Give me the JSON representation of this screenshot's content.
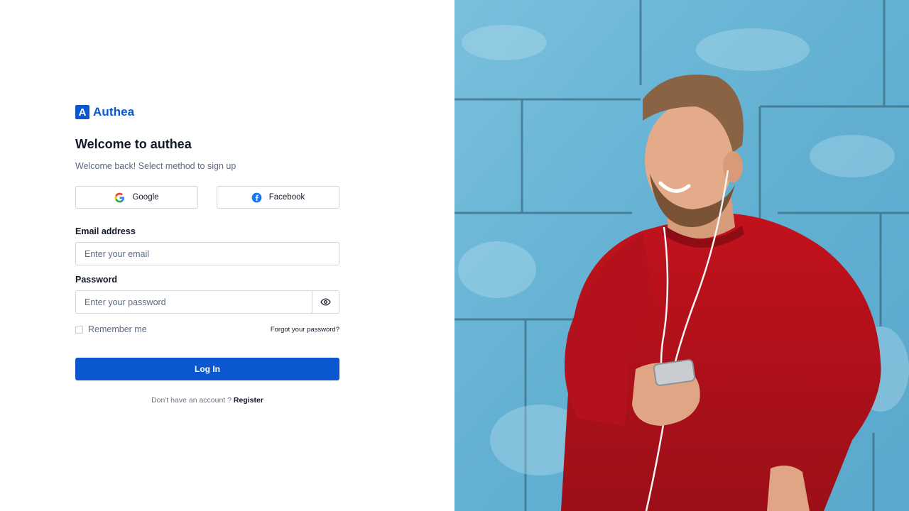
{
  "brand": {
    "mark": "A",
    "name": "Authea"
  },
  "heading": {
    "title": "Welcome to authea",
    "subtitle": "Welcome back! Select method to sign up"
  },
  "social": {
    "google_label": "Google",
    "facebook_label": "Facebook"
  },
  "email": {
    "label": "Email address",
    "placeholder": "Enter your email",
    "value": ""
  },
  "password": {
    "label": "Password",
    "placeholder": "Enter your password",
    "value": ""
  },
  "remember": {
    "label": "Remember me",
    "checked": false
  },
  "forgot": {
    "label": "Forgot your password?"
  },
  "login": {
    "label": "Log In"
  },
  "register": {
    "prompt": "Don't have an account ?",
    "link_label": "Register"
  },
  "colors": {
    "accent": "#0b57d0",
    "muted_text": "#5b6b86",
    "border": "#d1d5db",
    "wall_blue": "#6bb6d4",
    "sweater_red": "#b5121b"
  },
  "icons": {
    "google": "google-icon",
    "facebook": "facebook-icon",
    "eye": "eye-icon"
  }
}
